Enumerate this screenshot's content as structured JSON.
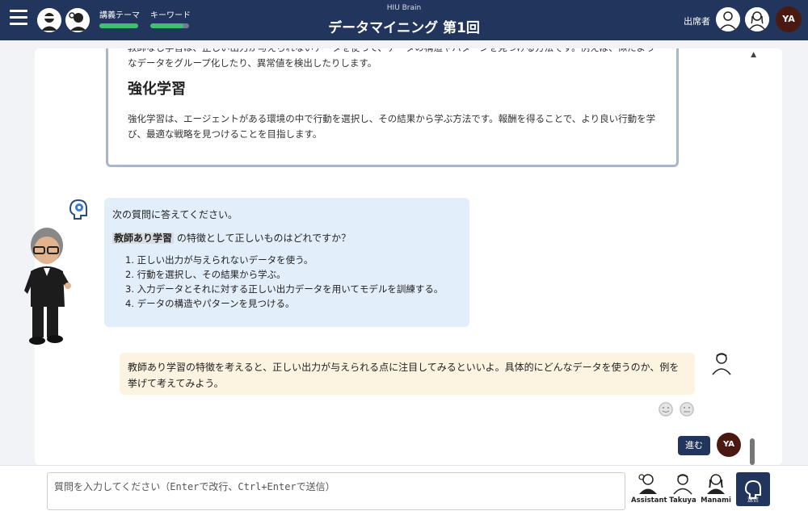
{
  "header": {
    "app_name": "HIU Brain",
    "title": "データマイニング 第1回",
    "meters": [
      {
        "label": "講義テーマ",
        "progress": 1.0
      },
      {
        "label": "キーワード",
        "progress": 0.85
      }
    ],
    "attendees_label": "出席者",
    "user_initials": "YA"
  },
  "document": {
    "top_text": "教師なし学習は、正しい出力が与えられないデータを使って、データの構造やパターンを見つける方法です。例えば、似たようなデータをグループ化したり、異常値を検出したりします。",
    "heading": "強化学習",
    "body": "強化学習は、エージェントがある環境の中で行動を選択し、その結果から学ぶ方法です。報酬を得ることで、より良い行動を学び、最適な戦略を見つけることを目指します。"
  },
  "question": {
    "intro": "次の質問に答えてください。",
    "keyword": "教師あり学習",
    "prompt": "の特徴として正しいものはどれですか？",
    "options": [
      "1. 正しい出力が与えられないデータを使う。",
      "2. 行動を選択し、その結果から学ぶ。",
      "3. 入力データとそれに対する正しい出力データを用いてモデルを訓練する。",
      "4. データの構造やパターンを見つける。"
    ]
  },
  "assistant_message": "教師あり学習の特徴を考えると、正しい出力が与えられる点に注目してみるといいよ。具体的にどんなデータを使うのか、例を挙げて考えてみよう。",
  "controls": {
    "next_label": "進む",
    "user_initials": "YA"
  },
  "footer": {
    "input_placeholder": "質問を入力してください（Enterで改行、Ctrl+Enterで送信）",
    "personas": [
      "Assistant",
      "Takuya",
      "Manami"
    ],
    "send_label": "送信"
  }
}
